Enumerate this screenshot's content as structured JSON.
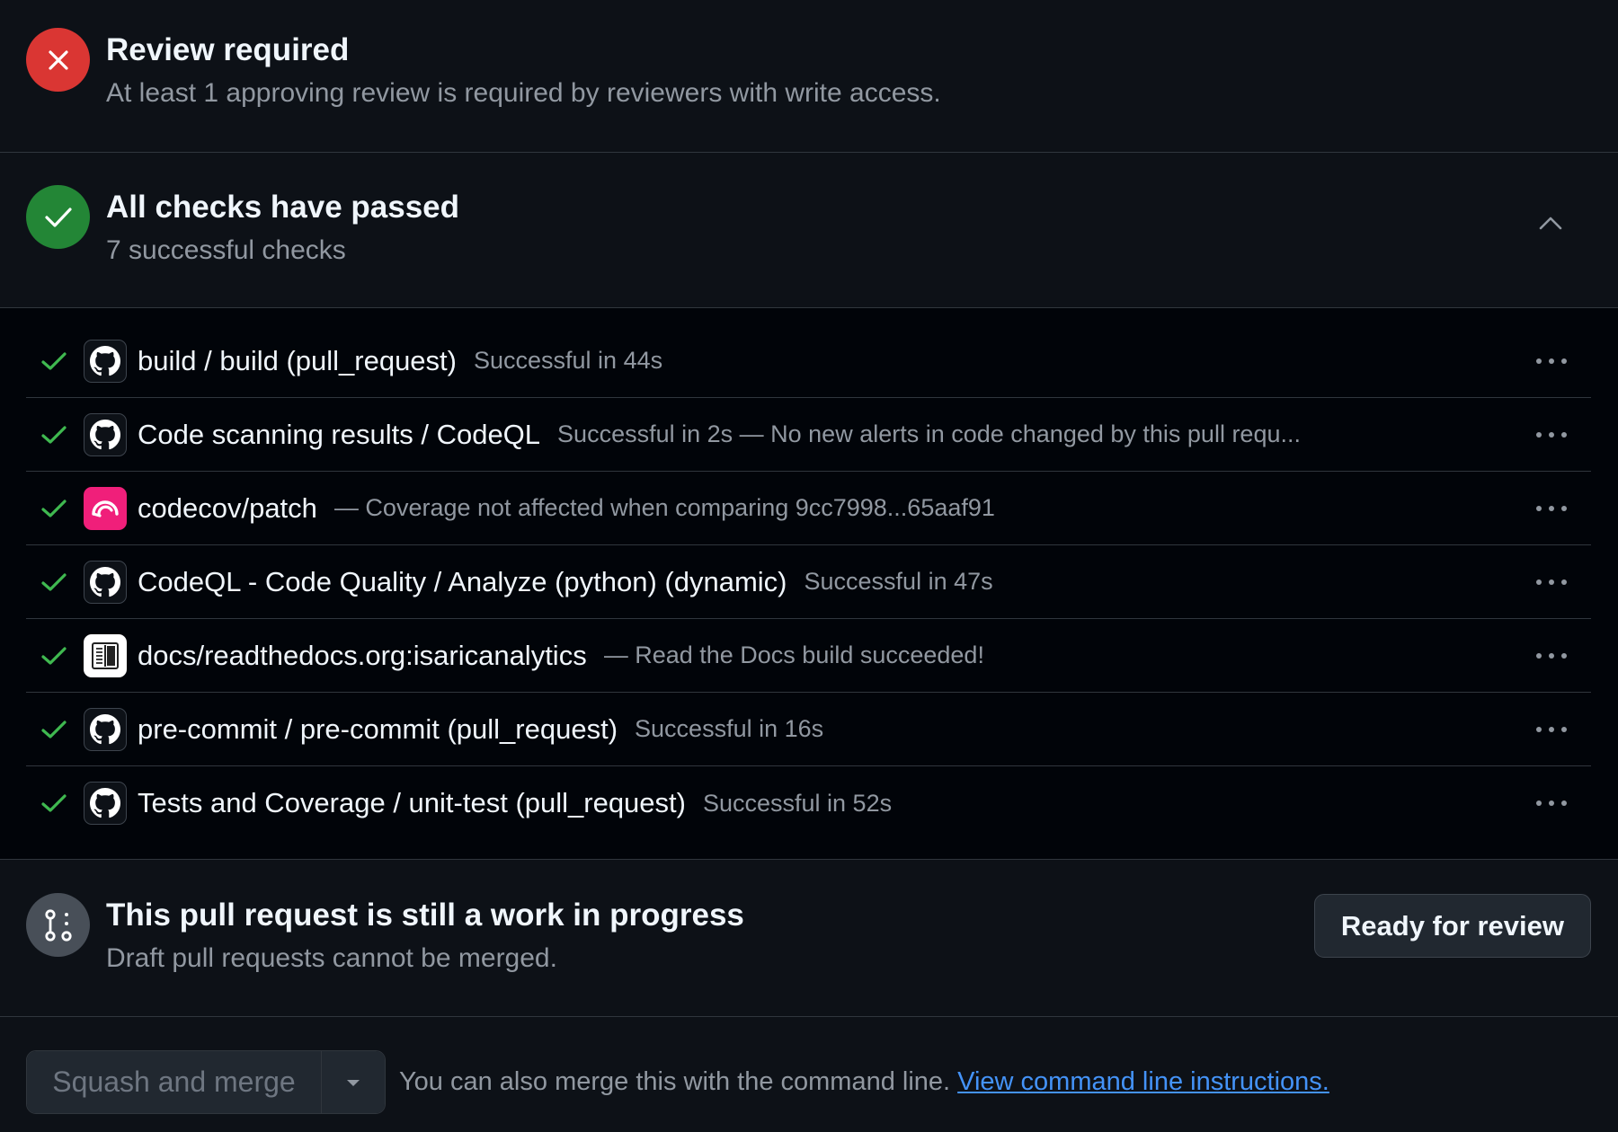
{
  "review": {
    "title": "Review required",
    "subtitle": "At least 1 approving review is required by reviewers with write access.",
    "icon": "x-icon",
    "color": "#da3633"
  },
  "checks_summary": {
    "title": "All checks have passed",
    "subtitle": "7 successful checks",
    "icon": "check-icon",
    "color": "#238636"
  },
  "checks": [
    {
      "name": "build / build (pull_request)",
      "desc": "Successful in 44s",
      "app": "github"
    },
    {
      "name": "Code scanning results / CodeQL",
      "desc": "Successful in 2s — No new alerts in code changed by this pull requ...",
      "app": "github"
    },
    {
      "name": "codecov/patch",
      "desc": "— Coverage not affected when comparing 9cc7998...65aaf91",
      "app": "codecov"
    },
    {
      "name": "CodeQL - Code Quality / Analyze (python) (dynamic)",
      "desc": "Successful in 47s",
      "app": "github"
    },
    {
      "name": "docs/readthedocs.org:isaricanalytics",
      "desc": "— Read the Docs build succeeded!",
      "app": "readthedocs"
    },
    {
      "name": "pre-commit / pre-commit (pull_request)",
      "desc": "Successful in 16s",
      "app": "github"
    },
    {
      "name": "Tests and Coverage / unit-test (pull_request)",
      "desc": "Successful in 52s",
      "app": "github"
    }
  ],
  "wip": {
    "title": "This pull request is still a work in progress",
    "subtitle": "Draft pull requests cannot be merged.",
    "ready_label": "Ready for review",
    "icon": "git-pull-request-draft-icon"
  },
  "merge": {
    "button_label": "Squash and merge",
    "hint": "You can also merge this with the command line.",
    "link_label": "View command line instructions."
  },
  "colors": {
    "background": "#0d1117",
    "check_green": "#3fb950",
    "link_blue": "#4493f8",
    "muted_text": "#9198a1"
  }
}
